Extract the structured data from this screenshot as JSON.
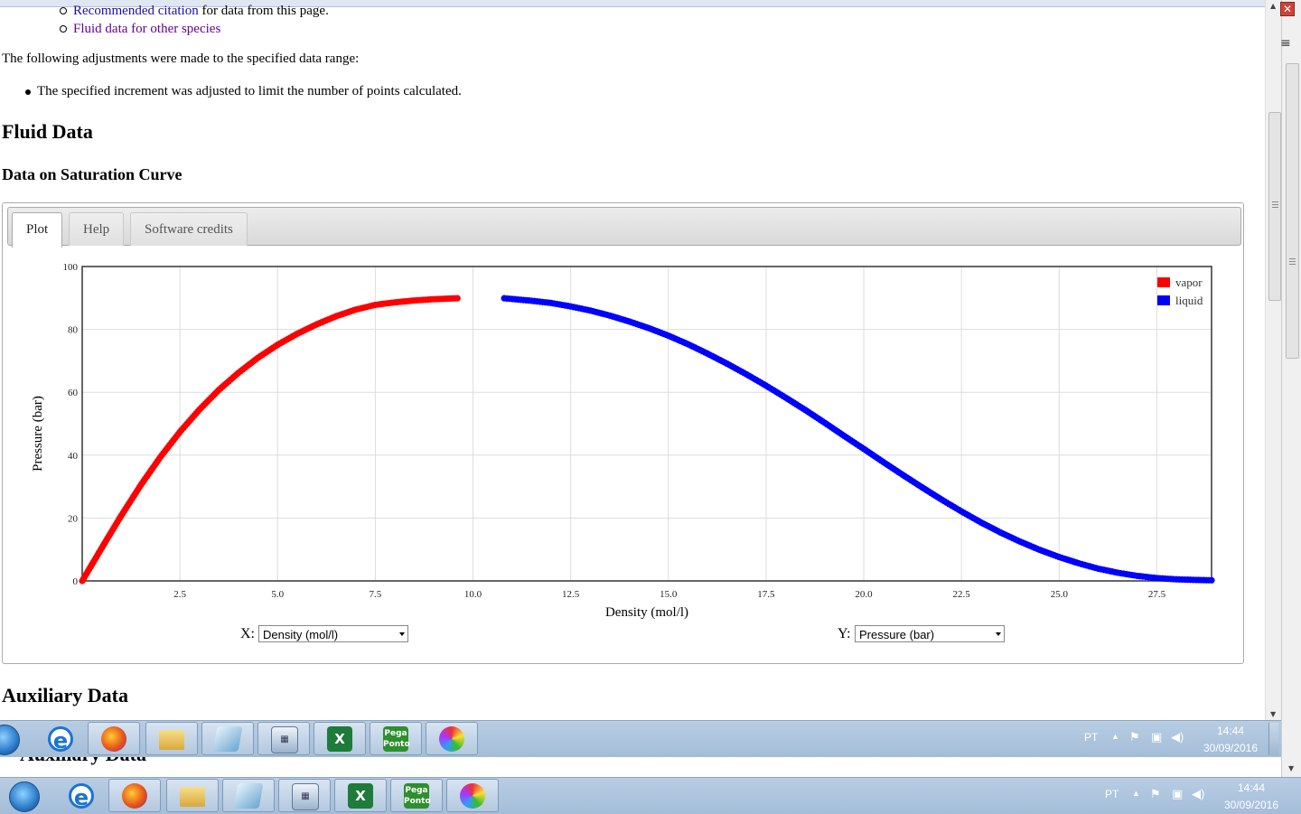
{
  "links": {
    "citation_link": "Recommended citation",
    "citation_rest": " for data from this page.",
    "other_species": "Fluid data for other species"
  },
  "adjust_text": "The following adjustments were made to the specified data range:",
  "adjust_bullet": "The specified increment was adjusted to limit the number of points calculated.",
  "fluid_heading": "Fluid Data",
  "saturation_heading": "Data on Saturation Curve",
  "tabs": [
    {
      "label": "Plot",
      "active": true
    },
    {
      "label": "Help",
      "active": false
    },
    {
      "label": "Software credits",
      "active": false
    }
  ],
  "chart_data": {
    "type": "scatter",
    "xlabel": "Density (mol/l)",
    "ylabel": "Pressure (bar)",
    "xlim": [
      0.0,
      28.9
    ],
    "ylim": [
      0,
      100
    ],
    "xticks": [
      2.5,
      5.0,
      7.5,
      10.0,
      12.5,
      15.0,
      17.5,
      20.0,
      22.5,
      25.0,
      27.5
    ],
    "xtick_labels": [
      "2.5",
      "5.0",
      "7.5",
      "10.0",
      "12.5",
      "15.0",
      "17.5",
      "20.0",
      "22.5",
      "25.0",
      "27.5"
    ],
    "yticks": [
      0,
      20,
      40,
      60,
      80,
      100
    ],
    "ytick_labels": [
      "0",
      "20",
      "40",
      "60",
      "80",
      "100"
    ],
    "grid": true,
    "legend_position": "top-right",
    "series": [
      {
        "name": "vapor",
        "color": "#ff0000",
        "x": [
          0.0,
          0.5,
          1.0,
          1.5,
          2.0,
          2.5,
          3.0,
          3.5,
          4.0,
          4.5,
          5.0,
          5.5,
          6.0,
          6.5,
          7.0,
          7.5,
          8.0,
          8.5,
          9.0,
          9.6
        ],
        "y": [
          0.0,
          10.5,
          20.8,
          30.5,
          39.4,
          47.4,
          54.5,
          60.8,
          66.2,
          71.0,
          75.1,
          78.6,
          81.6,
          84.2,
          86.3,
          87.8,
          88.6,
          89.2,
          89.6,
          89.9
        ]
      },
      {
        "name": "liquid",
        "color": "#0000ff",
        "x": [
          10.8,
          11.5,
          12.0,
          12.5,
          13.0,
          13.5,
          14.0,
          14.5,
          15.0,
          15.5,
          16.0,
          16.5,
          17.0,
          17.5,
          18.0,
          18.5,
          19.0,
          19.5,
          20.0,
          20.5,
          21.0,
          21.5,
          22.0,
          22.5,
          23.0,
          23.5,
          24.0,
          24.5,
          25.0,
          25.5,
          26.0,
          26.5,
          27.0,
          27.5,
          28.0,
          28.5,
          28.9
        ],
        "y": [
          89.9,
          89.1,
          88.4,
          87.3,
          86.0,
          84.4,
          82.5,
          80.4,
          78.0,
          75.3,
          72.3,
          69.1,
          65.7,
          62.1,
          58.3,
          54.4,
          50.3,
          46.1,
          42.0,
          37.8,
          33.7,
          29.7,
          25.8,
          22.1,
          18.6,
          15.4,
          12.5,
          9.9,
          7.6,
          5.6,
          3.9,
          2.6,
          1.6,
          0.9,
          0.5,
          0.3,
          0.2
        ]
      }
    ]
  },
  "x_select": {
    "label": "X:",
    "value": "Density (mol/l)"
  },
  "y_select": {
    "label": "Y:",
    "value": "Pressure (bar)"
  },
  "aux_heading": "Auxiliary Data",
  "taskbar": {
    "lang": "PT",
    "time": "14:44",
    "date": "30/09/2016",
    "icons": [
      "windows-start-icon",
      "internet-explorer-icon",
      "firefox-icon",
      "folder-icon",
      "notepad-icon",
      "calculator-icon",
      "excel-icon",
      "pega-ponto-icon",
      "paint-icon"
    ],
    "pega_label": "Pega Ponto"
  },
  "window": {
    "close_glyph": "✕",
    "menu_glyph": "≡"
  }
}
